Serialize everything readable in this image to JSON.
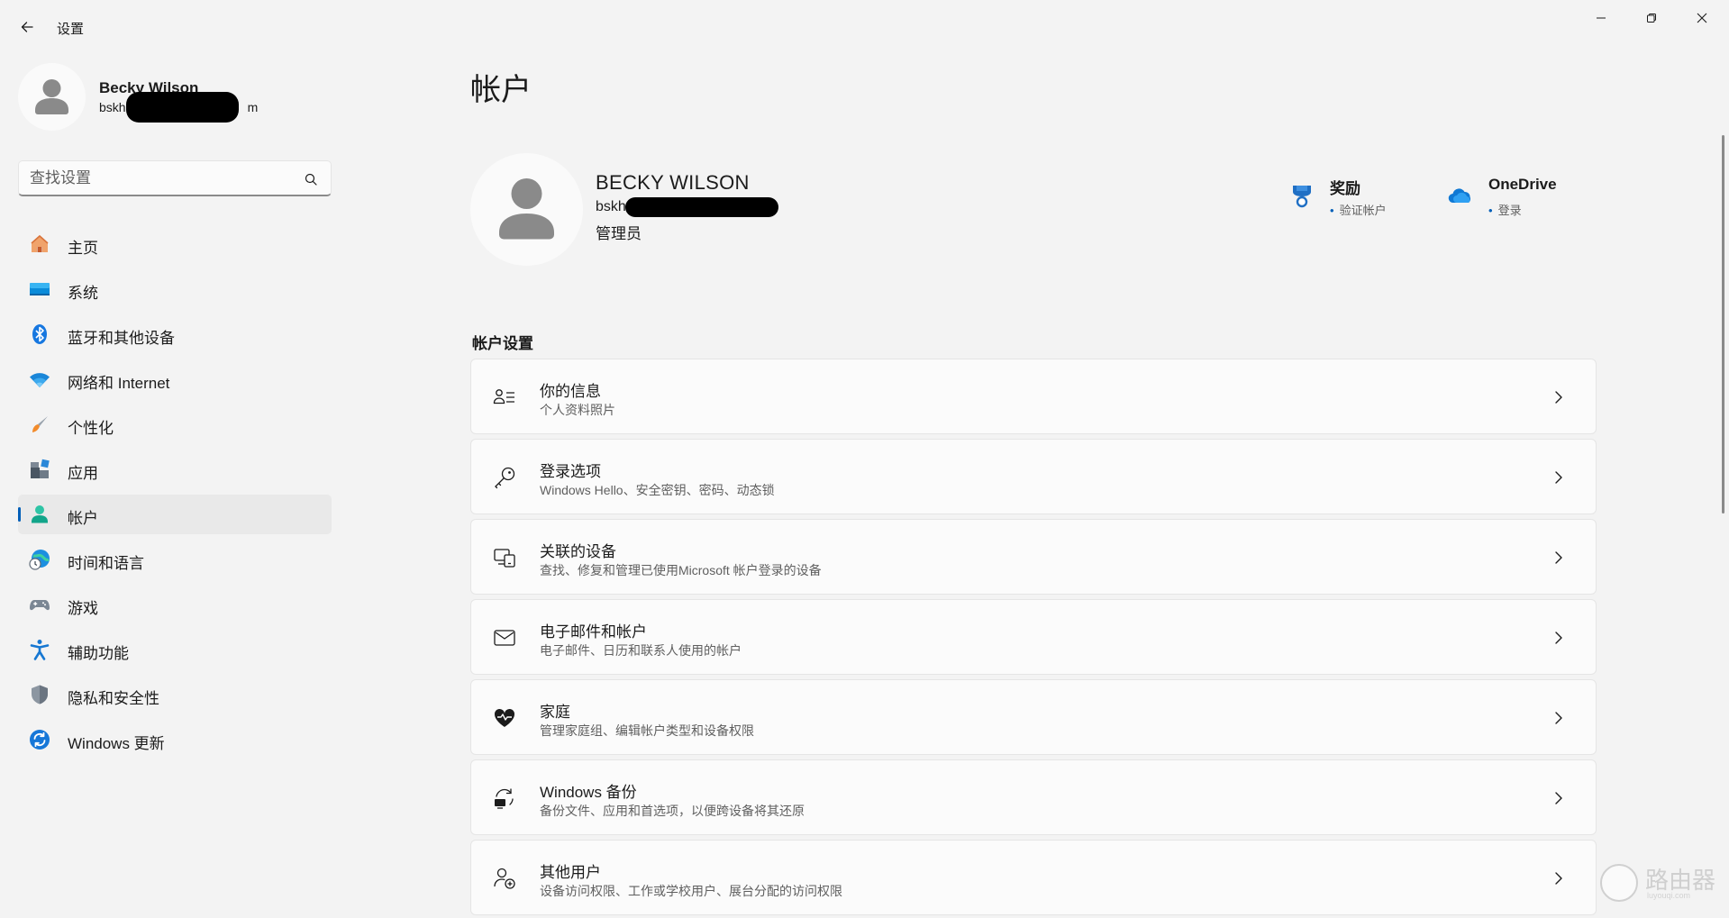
{
  "window": {
    "title": "设置"
  },
  "profile": {
    "name": "Becky Wilson",
    "email_visible": "bskh",
    "email_suffix": "m"
  },
  "search": {
    "placeholder": "查找设置"
  },
  "nav": {
    "items": [
      {
        "label": "主页",
        "icon": "home-icon"
      },
      {
        "label": "系统",
        "icon": "system-icon"
      },
      {
        "label": "蓝牙和其他设备",
        "icon": "bluetooth-icon"
      },
      {
        "label": "网络和 Internet",
        "icon": "wifi-icon"
      },
      {
        "label": "个性化",
        "icon": "brush-icon"
      },
      {
        "label": "应用",
        "icon": "apps-icon"
      },
      {
        "label": "帐户",
        "icon": "account-icon",
        "active": true
      },
      {
        "label": "时间和语言",
        "icon": "globe-clock-icon"
      },
      {
        "label": "游戏",
        "icon": "gamepad-icon"
      },
      {
        "label": "辅助功能",
        "icon": "accessibility-icon"
      },
      {
        "label": "隐私和安全性",
        "icon": "shield-icon"
      },
      {
        "label": "Windows 更新",
        "icon": "update-icon"
      }
    ]
  },
  "main": {
    "title": "帐户",
    "account": {
      "name": "BECKY WILSON",
      "email_visible": "bskh",
      "role": "管理员"
    },
    "quick": {
      "rewards": {
        "title": "奖励",
        "sub": "验证帐户"
      },
      "onedrive": {
        "title": "OneDrive",
        "sub": "登录"
      }
    },
    "section_label": "帐户设置",
    "cards": [
      {
        "title": "你的信息",
        "desc": "个人资料照片",
        "icon": "person-info-icon"
      },
      {
        "title": "登录选项",
        "desc": "Windows Hello、安全密钥、密码、动态锁",
        "icon": "key-icon"
      },
      {
        "title": "关联的设备",
        "desc": "查找、修复和管理已使用Microsoft 帐户登录的设备",
        "icon": "devices-icon"
      },
      {
        "title": "电子邮件和帐户",
        "desc": "电子邮件、日历和联系人使用的帐户",
        "icon": "mail-icon"
      },
      {
        "title": "家庭",
        "desc": "管理家庭组、编辑帐户类型和设备权限",
        "icon": "family-heart-icon"
      },
      {
        "title": "Windows 备份",
        "desc": "备份文件、应用和首选项，以便跨设备将其还原",
        "icon": "backup-icon"
      },
      {
        "title": "其他用户",
        "desc": "设备访问权限、工作或学校用户、展台分配的访问权限",
        "icon": "add-user-icon"
      }
    ]
  },
  "watermark": {
    "text": "路由器",
    "sub": "luyouqi.com"
  },
  "colors": {
    "accent": "#005fb8",
    "background": "#f3f3f3",
    "card": "#fbfbfb"
  }
}
